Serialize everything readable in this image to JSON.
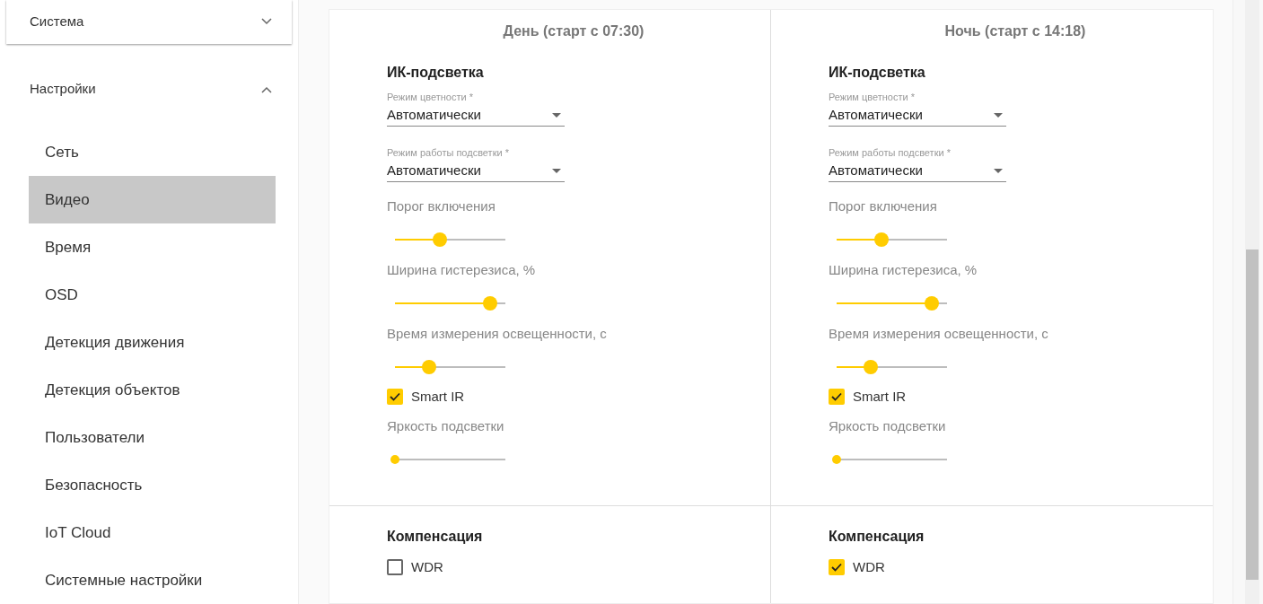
{
  "sidebar": {
    "groups": [
      {
        "label": "Система",
        "expanded": false
      },
      {
        "label": "Настройки",
        "expanded": true,
        "items": [
          {
            "label": "Сеть",
            "selected": false
          },
          {
            "label": "Видео",
            "selected": true
          },
          {
            "label": "Время",
            "selected": false
          },
          {
            "label": "OSD",
            "selected": false
          },
          {
            "label": "Детекция движения",
            "selected": false
          },
          {
            "label": "Детекция объектов",
            "selected": false
          },
          {
            "label": "Пользователи",
            "selected": false
          },
          {
            "label": "Безопасность",
            "selected": false
          },
          {
            "label": "IoT Cloud",
            "selected": false
          },
          {
            "label": "Системные настройки",
            "selected": false
          }
        ]
      }
    ]
  },
  "columns": [
    {
      "header": "День (старт с 07:30)",
      "section": "ИК-подсветка",
      "fields": [
        {
          "kind": "select",
          "label": "Режим цветности *",
          "value": "Автоматически"
        },
        {
          "kind": "select",
          "label": "Режим работы подсветки *",
          "value": "Автоматически"
        },
        {
          "kind": "slider",
          "label": "Порог включения",
          "level": 0.41
        },
        {
          "kind": "slider",
          "label": "Ширина гистерезиса, %",
          "level": 0.86
        },
        {
          "kind": "slider",
          "label": "Время измерения освещенности, с",
          "level": 0.31
        },
        {
          "kind": "checkbox",
          "label": "Smart IR",
          "checked": true
        },
        {
          "kind": "slider",
          "label": "Яркость подсветки",
          "level": 0
        }
      ],
      "compensation": {
        "title": "Компенсация",
        "options": [
          {
            "label": "WDR",
            "checked": false
          }
        ]
      }
    },
    {
      "header": "Ночь (старт с 14:18)",
      "section": "ИК-подсветка",
      "fields": [
        {
          "kind": "select",
          "label": "Режим цветности *",
          "value": "Автоматически"
        },
        {
          "kind": "select",
          "label": "Режим работы подсветки *",
          "value": "Автоматически"
        },
        {
          "kind": "slider",
          "label": "Порог включения",
          "level": 0.41
        },
        {
          "kind": "slider",
          "label": "Ширина гистерезиса, %",
          "level": 0.86
        },
        {
          "kind": "slider",
          "label": "Время измерения освещенности, с",
          "level": 0.31
        },
        {
          "kind": "checkbox",
          "label": "Smart IR",
          "checked": true
        },
        {
          "kind": "slider",
          "label": "Яркость подсветки",
          "level": 0
        }
      ],
      "compensation": {
        "title": "Компенсация",
        "options": [
          {
            "label": "WDR",
            "checked": true
          }
        ]
      }
    }
  ]
}
